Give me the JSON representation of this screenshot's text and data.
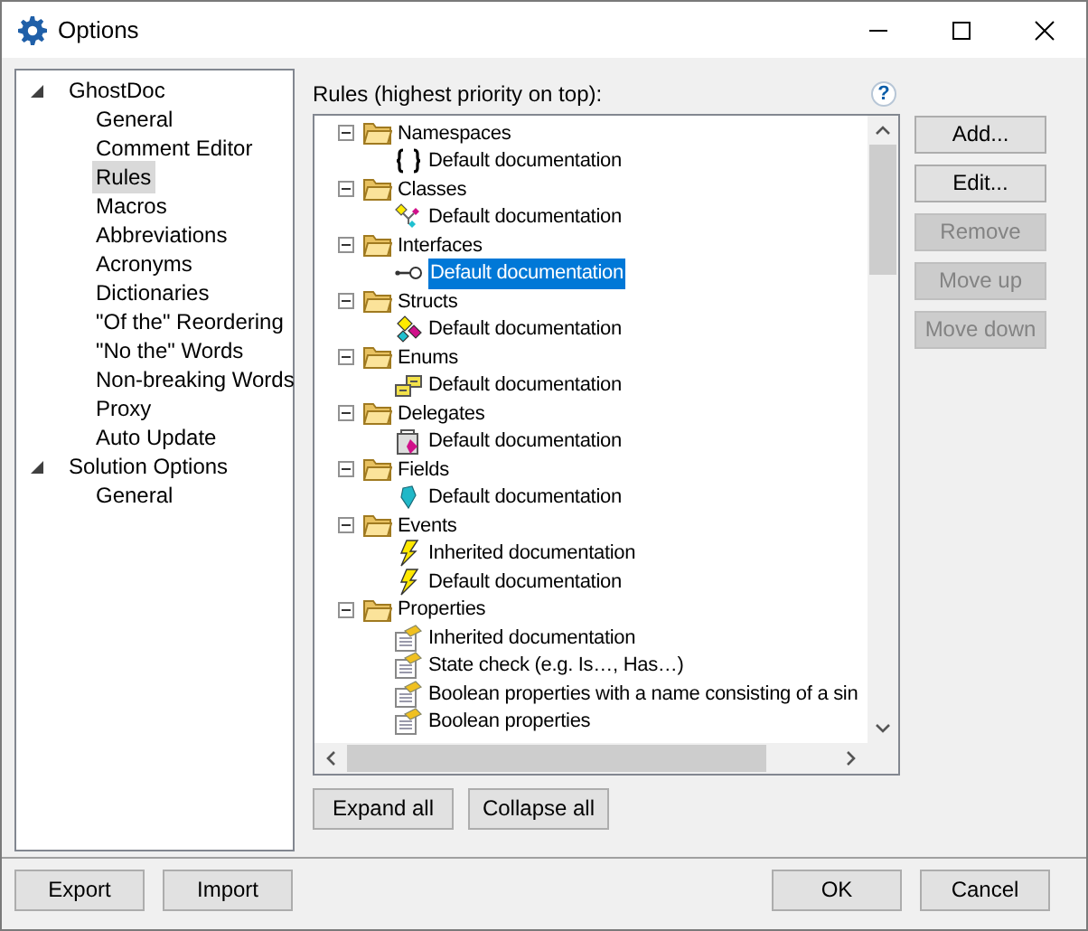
{
  "window": {
    "title": "Options"
  },
  "sidebar": {
    "items": [
      {
        "label": "GhostDoc",
        "expanded": true,
        "selected": false,
        "children": [
          {
            "label": "General",
            "selected": false
          },
          {
            "label": "Comment Editor",
            "selected": false
          },
          {
            "label": "Rules",
            "selected": true
          },
          {
            "label": "Macros",
            "selected": false
          },
          {
            "label": "Abbreviations",
            "selected": false
          },
          {
            "label": "Acronyms",
            "selected": false
          },
          {
            "label": "Dictionaries",
            "selected": false
          },
          {
            "label": "\"Of the\" Reordering",
            "selected": false
          },
          {
            "label": "\"No the\" Words",
            "selected": false
          },
          {
            "label": "Non-breaking Words",
            "selected": false
          },
          {
            "label": "Proxy",
            "selected": false
          },
          {
            "label": "Auto Update",
            "selected": false
          }
        ]
      },
      {
        "label": "Solution Options",
        "expanded": true,
        "selected": false,
        "children": [
          {
            "label": "General",
            "selected": false
          }
        ]
      }
    ]
  },
  "rules": {
    "label": "Rules (highest priority on top):",
    "help": "?",
    "groups": [
      {
        "label": "Namespaces",
        "expanded": true,
        "children": [
          {
            "label": "Default documentation",
            "kind": "braces",
            "selected": false
          }
        ]
      },
      {
        "label": "Classes",
        "expanded": true,
        "children": [
          {
            "label": "Default documentation",
            "kind": "class",
            "selected": false
          }
        ]
      },
      {
        "label": "Interfaces",
        "expanded": true,
        "children": [
          {
            "label": "Default documentation",
            "kind": "interface",
            "selected": true
          }
        ]
      },
      {
        "label": "Structs",
        "expanded": true,
        "children": [
          {
            "label": "Default documentation",
            "kind": "struct",
            "selected": false
          }
        ]
      },
      {
        "label": "Enums",
        "expanded": true,
        "children": [
          {
            "label": "Default documentation",
            "kind": "enum",
            "selected": false
          }
        ]
      },
      {
        "label": "Delegates",
        "expanded": true,
        "children": [
          {
            "label": "Default documentation",
            "kind": "delegate",
            "selected": false
          }
        ]
      },
      {
        "label": "Fields",
        "expanded": true,
        "children": [
          {
            "label": "Default documentation",
            "kind": "field",
            "selected": false
          }
        ]
      },
      {
        "label": "Events",
        "expanded": true,
        "children": [
          {
            "label": "Inherited documentation",
            "kind": "event",
            "selected": false
          },
          {
            "label": "Default documentation",
            "kind": "event",
            "selected": false
          }
        ]
      },
      {
        "label": "Properties",
        "expanded": true,
        "children": [
          {
            "label": "Inherited documentation",
            "kind": "property",
            "selected": false
          },
          {
            "label": "State check (e.g. Is…, Has…)",
            "kind": "property",
            "selected": false
          },
          {
            "label": "Boolean properties with a name consisting of a sin",
            "kind": "property",
            "selected": false
          },
          {
            "label": "Boolean properties",
            "kind": "property",
            "selected": false
          }
        ]
      }
    ]
  },
  "side_buttons": [
    {
      "label": "Add...",
      "disabled": false
    },
    {
      "label": "Edit...",
      "disabled": false
    },
    {
      "label": "Remove",
      "disabled": true
    },
    {
      "label": "Move up",
      "disabled": true
    },
    {
      "label": "Move down",
      "disabled": true
    }
  ],
  "tree_buttons": [
    {
      "label": "Expand all"
    },
    {
      "label": "Collapse all"
    }
  ],
  "footer_left": [
    {
      "label": "Export"
    },
    {
      "label": "Import"
    }
  ],
  "footer_right": [
    {
      "label": "OK"
    },
    {
      "label": "Cancel"
    }
  ]
}
